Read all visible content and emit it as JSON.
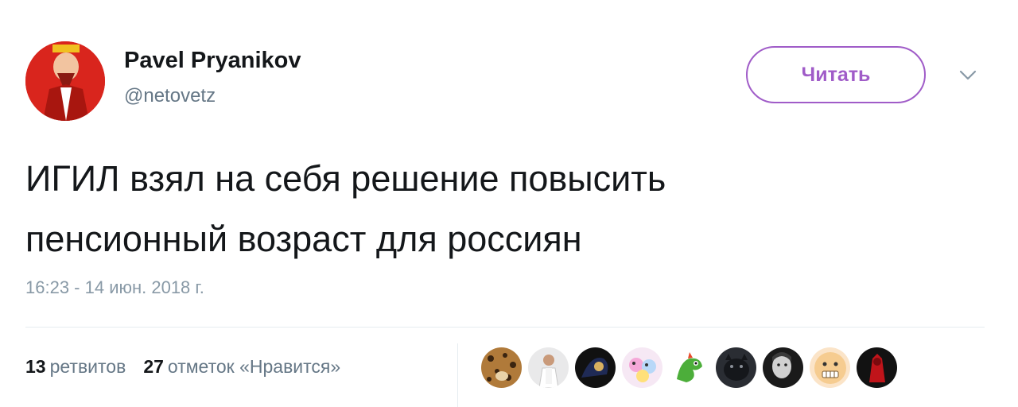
{
  "author": {
    "name": "Pavel Pryanikov",
    "handle": "@netovetz",
    "avatar_icon": "red-portrait-avatar-icon"
  },
  "follow_button": {
    "label": "Читать"
  },
  "menu_icon": "chevron-down-icon",
  "tweet": {
    "line1": "ИГИЛ взял на себя решение повысить",
    "line2": "пенсионный возраст для россиян",
    "timestamp": "16:23 - 14 июн. 2018 г."
  },
  "stats": {
    "retweets_count": "13",
    "retweets_label": "ретвитов",
    "likes_count": "27",
    "likes_label": "отметок «Нравится»"
  },
  "likers": [
    {
      "icon": "cheetah-avatar-icon"
    },
    {
      "icon": "person-white-avatar-icon"
    },
    {
      "icon": "dark-figure-avatar-icon"
    },
    {
      "icon": "cartoon-pink-avatar-icon"
    },
    {
      "icon": "green-dragon-avatar-icon"
    },
    {
      "icon": "dark-animal-avatar-icon"
    },
    {
      "icon": "bw-portrait-avatar-icon"
    },
    {
      "icon": "smiley-face-avatar-icon"
    },
    {
      "icon": "red-black-avatar-icon"
    }
  ],
  "colors": {
    "accent": "#a05cc8",
    "text": "#14171a",
    "muted": "#657786",
    "avatar_red": "#d9251d"
  }
}
